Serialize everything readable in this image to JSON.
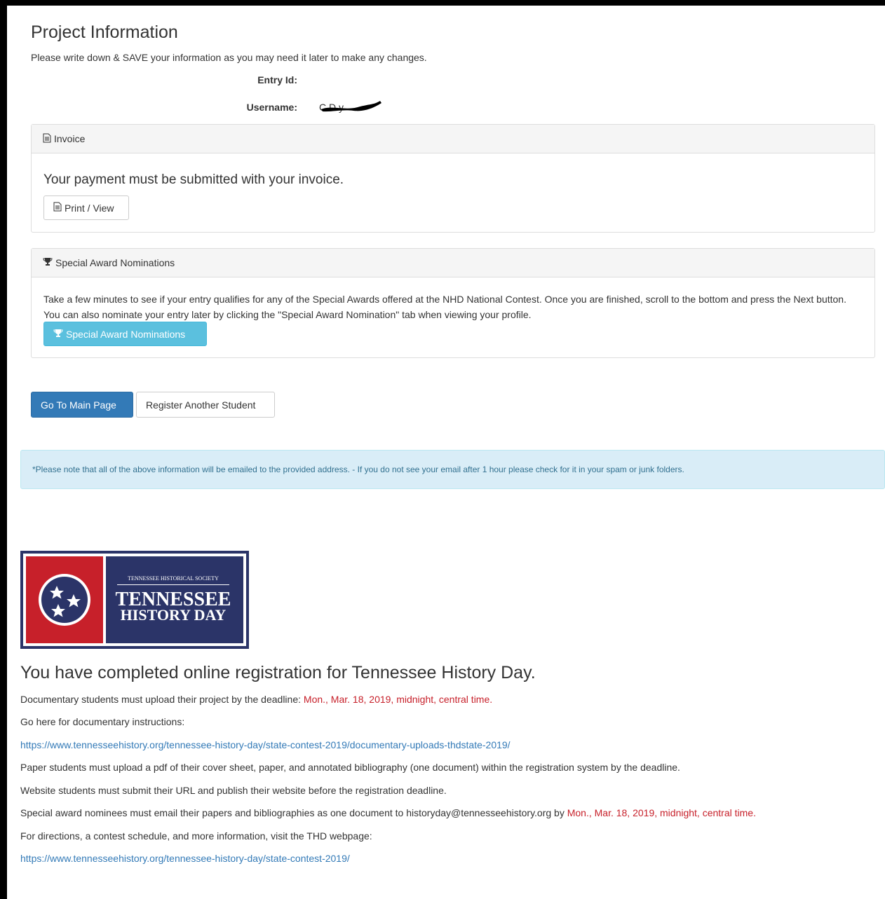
{
  "project": {
    "title": "Project Information",
    "note": "Please write down & SAVE your information as you may need it later to make any changes.",
    "entry_id_label": "Entry Id:",
    "entry_id_value": "",
    "username_label": "Username:",
    "username_value": "C        D    y"
  },
  "invoice": {
    "heading": "Invoice",
    "message": "Your payment must be submitted with your invoice.",
    "print_label": "Print / View"
  },
  "awards": {
    "heading": "Special Award Nominations",
    "text": "Take a few minutes to see if your entry qualifies for any of the Special Awards offered at the NHD National Contest. Once you are finished, scroll to the bottom and press the Next button. You can also nominate your entry later by clicking the \"Special Award Nomination\" tab when viewing your profile.",
    "button_label": "Special Award Nominations"
  },
  "actions": {
    "main_page_label": "Go To Main Page",
    "register_label": "Register Another Student"
  },
  "alert": {
    "text": "*Please note that all of the above information will be emailed to the provided address. - If you do not see your email after 1 hour please check for it in your spam or junk folders."
  },
  "logo": {
    "society": "TENNESSEE HISTORICAL SOCIETY",
    "line1": "TENNESSEE",
    "line2": "HISTORY DAY"
  },
  "completion": {
    "title": "You have completed online registration for Tennessee History Day.",
    "doc_deadline_text": "Documentary students must upload their project by the deadline: ",
    "doc_deadline_date": "Mon., Mar. 18, 2019, midnight, central time.",
    "doc_instructions_text": "Go here for documentary instructions:",
    "doc_link": "https://www.tennesseehistory.org/tennessee-history-day/state-contest-2019/documentary-uploads-thdstate-2019/",
    "paper_text": "Paper students must upload a pdf of their cover sheet, paper, and annotated bibliography (one document) within the registration system by the deadline.",
    "website_text": "Website students must submit their URL and publish their website before the registration deadline.",
    "special_text": "Special award nominees must email their papers and bibliographies as one document to historyday@tennesseehistory.org by ",
    "special_date": "Mon., Mar. 18, 2019, midnight, central time.",
    "directions_text": "For directions, a contest schedule, and more information, visit the THD webpage:",
    "state_link": "https://www.tennesseehistory.org/tennessee-history-day/state-contest-2019/"
  },
  "colors": {
    "primary": "#337ab7",
    "info": "#5bc0de",
    "alert_bg": "#d9edf7",
    "deadline_red": "#c7202a",
    "logo_navy": "#2b3468",
    "logo_red": "#c7202a"
  }
}
